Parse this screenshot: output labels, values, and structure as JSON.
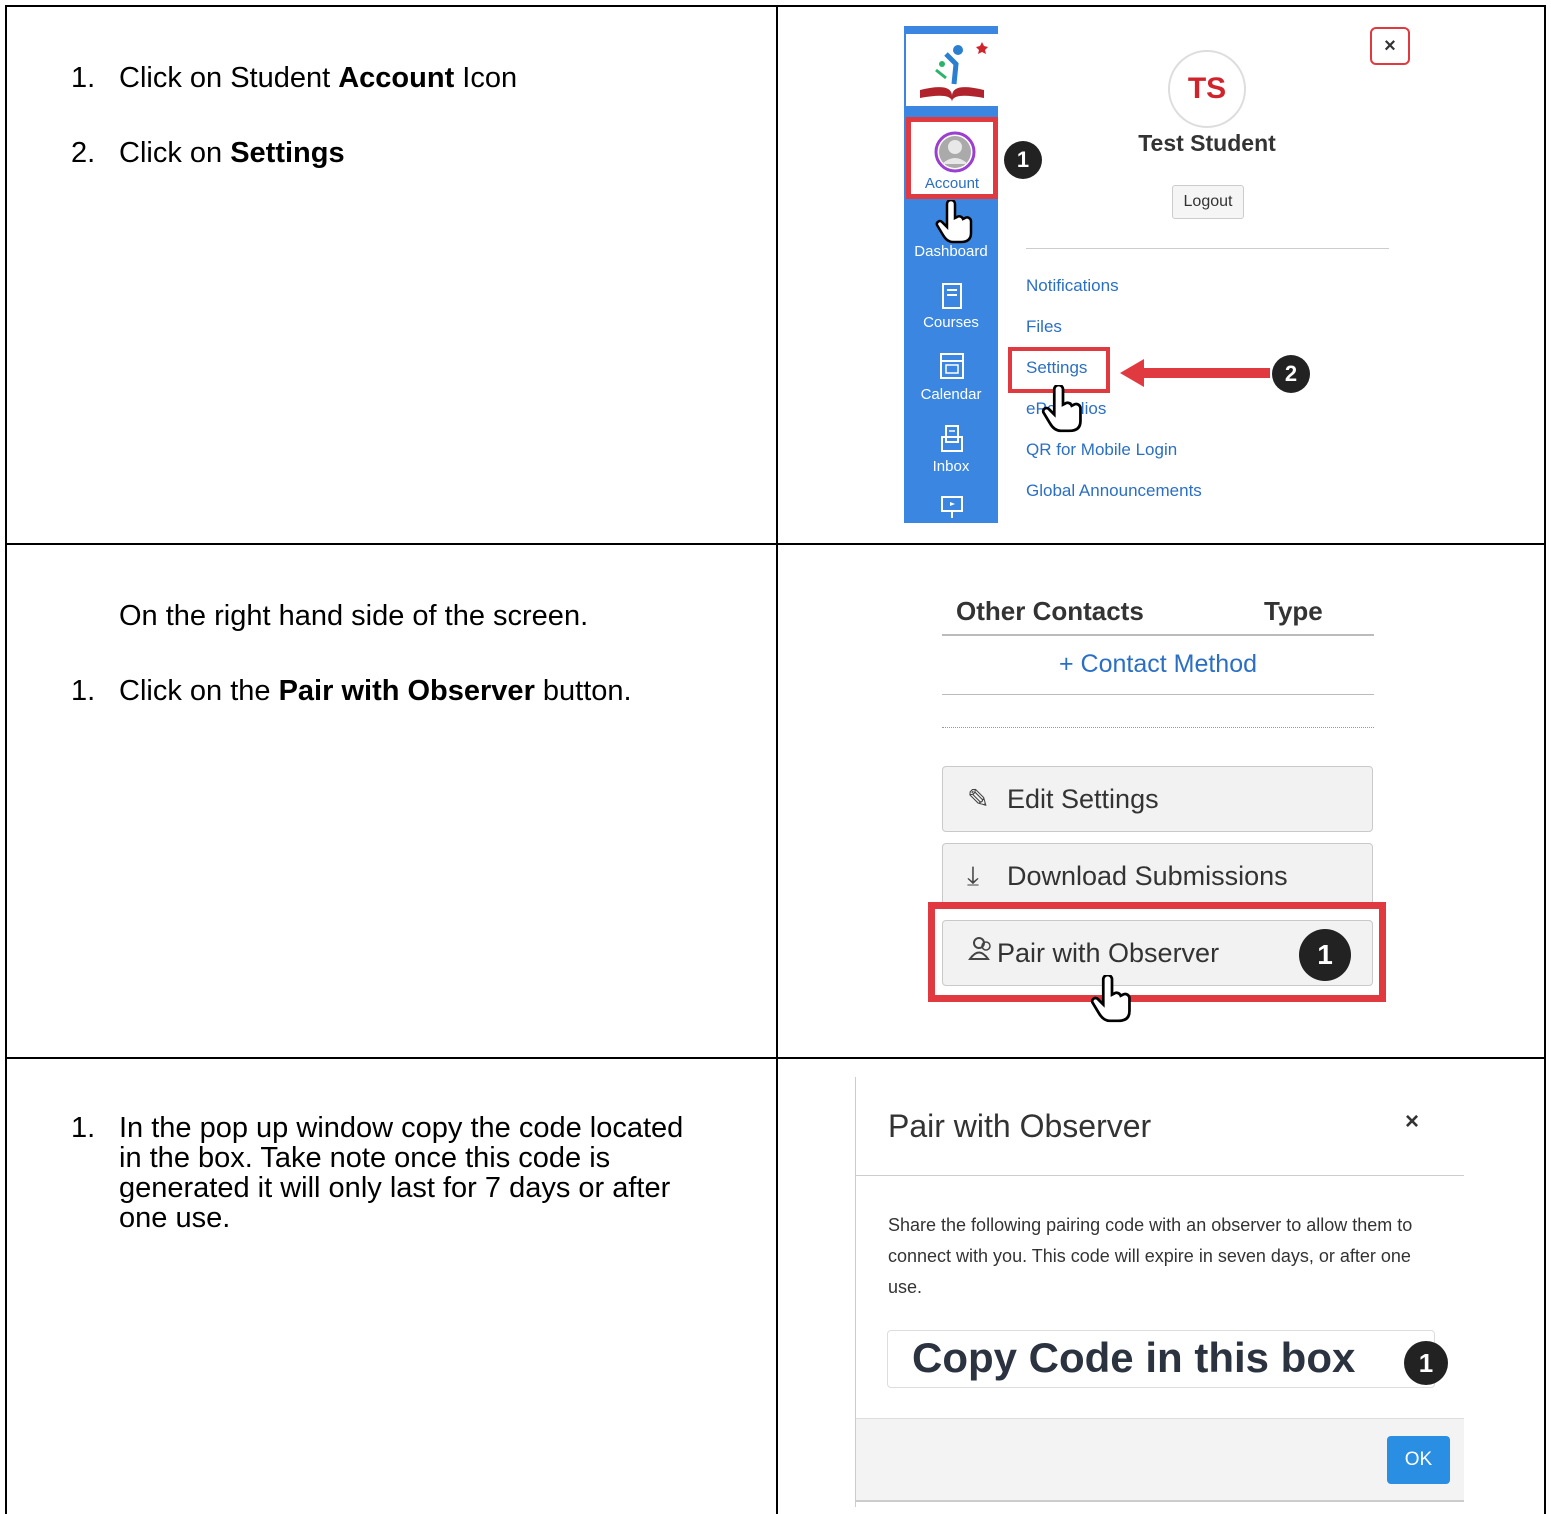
{
  "row1": {
    "steps": [
      {
        "num": "1.",
        "pre": "Click on Student ",
        "bold": "Account",
        "post": " Icon"
      },
      {
        "num": "2.",
        "pre": "Click on ",
        "bold": "Settings",
        "post": ""
      }
    ],
    "shot": {
      "nav": {
        "account": "Account",
        "dashboard": "Dashboard",
        "courses": "Courses",
        "calendar": "Calendar",
        "inbox": "Inbox"
      },
      "avatar_initials": "TS",
      "student_name": "Test Student",
      "logout": "Logout",
      "close": "×",
      "menu": [
        "Notifications",
        "Files",
        "Settings",
        "ePortfolios",
        "QR for Mobile Login",
        "Global Announcements"
      ],
      "badge1": "1",
      "badge2": "2"
    }
  },
  "row2": {
    "intro": "On the right hand side of the screen.",
    "step": {
      "num": "1.",
      "pre": "Click on the ",
      "bold": "Pair with Observer",
      "post": " button."
    },
    "shot": {
      "col1": "Other Contacts",
      "col2": "Type",
      "contact_method": "+ Contact Method",
      "edit_settings": "Edit Settings",
      "download_submissions": "Download Submissions",
      "pair_with_observer": "Pair with Observer",
      "badge": "1"
    }
  },
  "row3": {
    "step": {
      "num": "1.",
      "lines": [
        "In the pop up window copy the code located",
        "in the box. Take note once this code is",
        "generated it will only last for 7 days or after",
        "one use."
      ]
    },
    "shot": {
      "title": "Pair with Observer",
      "close": "×",
      "body": "Share the following pairing code with an observer to allow them to connect with you. This code will expire in seven days, or after one use.",
      "code_text": "Copy Code in this box",
      "badge": "1",
      "ok": "OK"
    }
  },
  "colors": {
    "accent_red": "#e03a40",
    "link_blue": "#2b6fc4",
    "nav_blue": "#3a86e0",
    "ok_blue": "#2a8ee3"
  }
}
